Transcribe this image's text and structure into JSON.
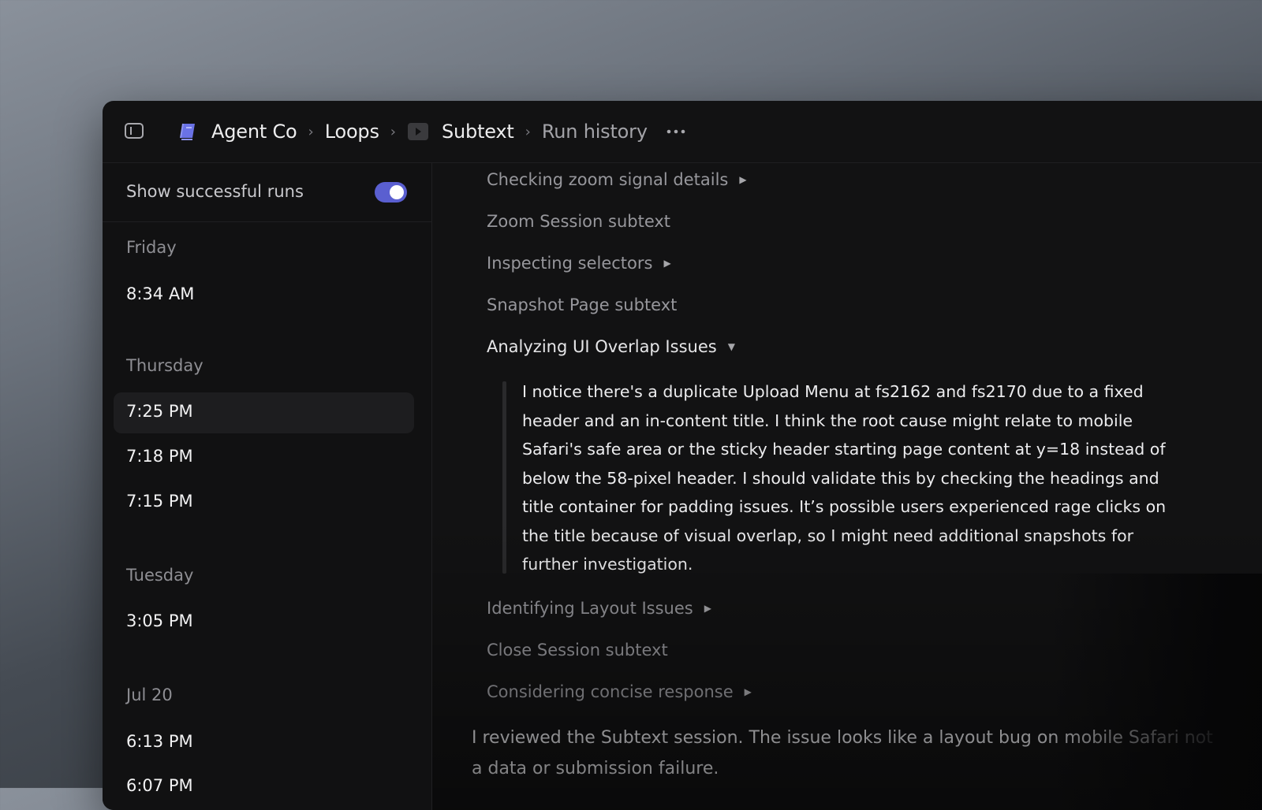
{
  "breadcrumb": {
    "workspace": "Agent Co",
    "section": "Loops",
    "loop": "Subtext",
    "page": "Run history"
  },
  "icons": {
    "sidebar_toggle": "sidebar-panel-icon",
    "workspace": "book-icon",
    "loop": "play-icon",
    "more": "ellipsis-icon",
    "collapsed": "triangle-right-icon",
    "expanded": "triangle-down-icon"
  },
  "colors": {
    "accent": "#5a5fd0",
    "book": "#6a72e6"
  },
  "sidebar": {
    "toggle_label": "Show successful runs",
    "toggle_on": true,
    "groups": [
      {
        "label": "Friday",
        "times": [
          "8:34 AM"
        ]
      },
      {
        "label": "Thursday",
        "times": [
          "7:25 PM",
          "7:18 PM",
          "7:15 PM"
        ]
      },
      {
        "label": "Tuesday",
        "times": [
          "3:05 PM"
        ]
      },
      {
        "label": "Jul 20",
        "times": [
          "6:13 PM",
          "6:07 PM"
        ]
      }
    ],
    "selected": "7:25 PM"
  },
  "steps": [
    {
      "label": "Checking zoom signal details",
      "expandable": true
    },
    {
      "label": "Zoom Session subtext",
      "expandable": false
    },
    {
      "label": "Inspecting selectors",
      "expandable": true
    },
    {
      "label": "Snapshot Page subtext",
      "expandable": false
    },
    {
      "label": "Analyzing UI Overlap Issues",
      "expandable": true,
      "expanded": true
    },
    {
      "label": "Identifying Layout Issues",
      "expandable": true
    },
    {
      "label": "Close Session subtext",
      "expandable": false
    },
    {
      "label": "Considering concise response",
      "expandable": true
    }
  ],
  "expanded_text": "I notice there's a duplicate Upload Menu at fs2162 and fs2170 due to a fixed header and an in-content title. I think the root cause might relate to mobile Safari's safe area or the sticky header starting page content at y=18 instead of below the 58-pixel header. I should validate this by checking the headings and title container for padding issues. It’s possible users experienced rage clicks on the title because of visual overlap, so I might need additional snapshots for further investigation.",
  "final_response": "I reviewed the Subtext session. The issue looks like a layout bug on mobile Safari not a data or submission failure."
}
